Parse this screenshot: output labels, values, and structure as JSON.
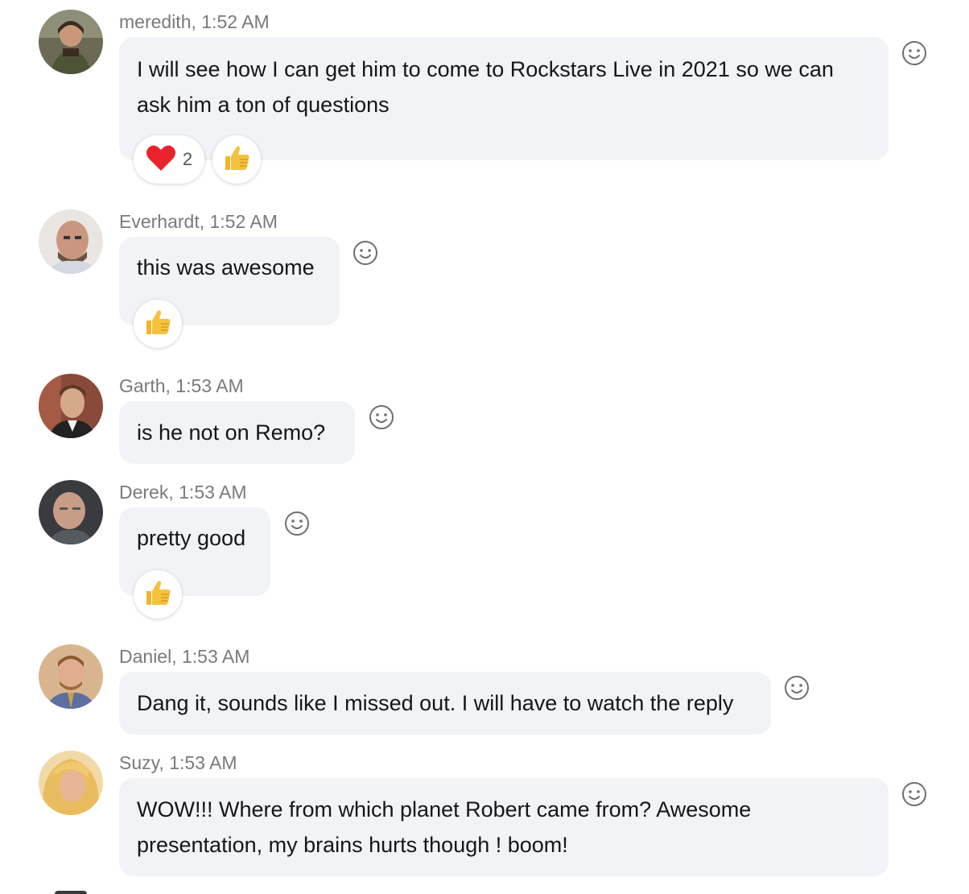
{
  "messages": [
    {
      "author": "meredith",
      "time_label": "meredith, 1:52 AM",
      "text_lines": [
        "I will see how I can get him to come to Rockstars Live in 2021 so we can",
        "ask him a ton of questions"
      ],
      "reactions": [
        {
          "emoji": "heart",
          "count": "2"
        },
        {
          "emoji": "thumbs-up",
          "count": ""
        }
      ]
    },
    {
      "author": "Everhardt",
      "time_label": "Everhardt, 1:52 AM",
      "text_lines": [
        "this was awesome"
      ],
      "reactions": [
        {
          "emoji": "thumbs-up",
          "count": ""
        }
      ]
    },
    {
      "author": "Garth",
      "time_label": "Garth, 1:53 AM",
      "text_lines": [
        "is he not on Remo?"
      ],
      "reactions": []
    },
    {
      "author": "Derek",
      "time_label": "Derek, 1:53 AM",
      "text_lines": [
        "pretty good"
      ],
      "reactions": [
        {
          "emoji": "thumbs-up",
          "count": ""
        }
      ]
    },
    {
      "author": "Daniel",
      "time_label": "Daniel, 1:53 AM",
      "text_lines": [
        "Dang it, sounds like I missed out. I will have to watch the reply"
      ],
      "reactions": []
    },
    {
      "author": "Suzy",
      "time_label": "Suzy, 1:53 AM",
      "text_lines": [
        "WOW!!! Where from which planet Robert came from? Awesome",
        "presentation, my brains hurts though ! boom!"
      ],
      "reactions": []
    }
  ],
  "colors": {
    "bubble": "#f1f3f6",
    "meta_text": "#7a7a7a",
    "heart": "#e8232b",
    "thumb": "#f5c23d"
  },
  "icons": {
    "add_reaction": "smiley-face-icon",
    "heart": "heart-icon",
    "thumbs_up": "thumbs-up-icon"
  }
}
